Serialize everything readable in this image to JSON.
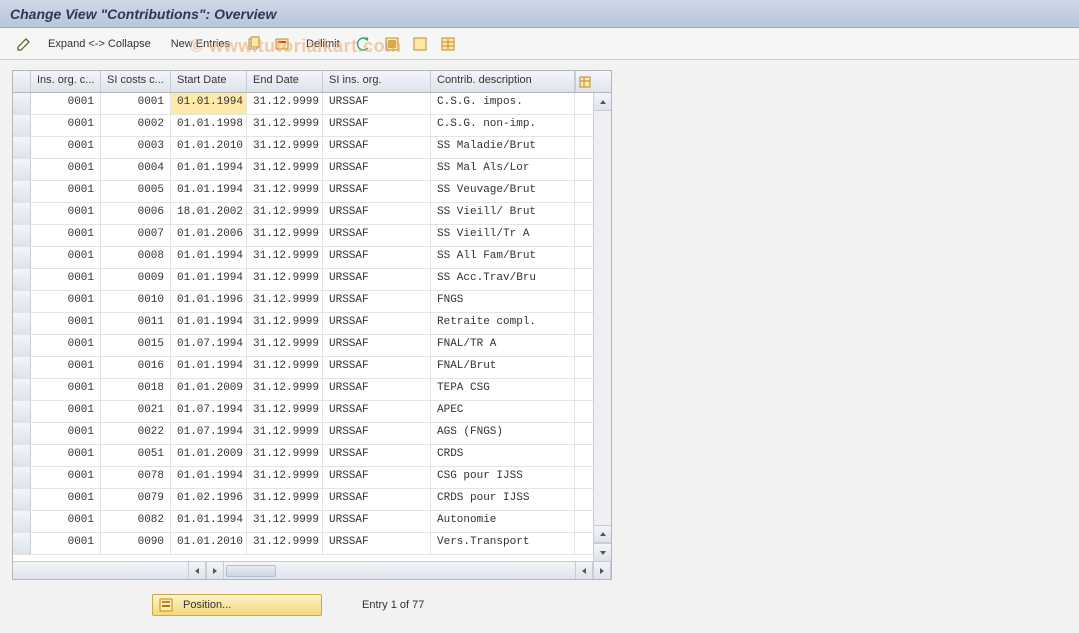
{
  "title": "Change View \"Contributions\": Overview",
  "toolbar": {
    "expand_collapse": "Expand <-> Collapse",
    "new_entries": "New Entries",
    "delimit": "Delimit"
  },
  "columns": {
    "mark": "",
    "ins_org": "Ins. org. c...",
    "si_costs": "SI costs c...",
    "start": "Start Date",
    "end": "End Date",
    "si_ins_org": "SI ins. org.",
    "contrib": "Contrib. description"
  },
  "rows": [
    {
      "org": "0001",
      "cost": "0001",
      "start": "01.01.1994",
      "end": "31.12.9999",
      "si": "URSSAF",
      "desc": "C.S.G. impos."
    },
    {
      "org": "0001",
      "cost": "0002",
      "start": "01.01.1998",
      "end": "31.12.9999",
      "si": "URSSAF",
      "desc": "C.S.G. non-imp."
    },
    {
      "org": "0001",
      "cost": "0003",
      "start": "01.01.2010",
      "end": "31.12.9999",
      "si": "URSSAF",
      "desc": "SS Maladie/Brut"
    },
    {
      "org": "0001",
      "cost": "0004",
      "start": "01.01.1994",
      "end": "31.12.9999",
      "si": "URSSAF",
      "desc": "SS Mal Als/Lor"
    },
    {
      "org": "0001",
      "cost": "0005",
      "start": "01.01.1994",
      "end": "31.12.9999",
      "si": "URSSAF",
      "desc": "SS Veuvage/Brut"
    },
    {
      "org": "0001",
      "cost": "0006",
      "start": "18.01.2002",
      "end": "31.12.9999",
      "si": "URSSAF",
      "desc": "SS Vieill/ Brut"
    },
    {
      "org": "0001",
      "cost": "0007",
      "start": "01.01.2006",
      "end": "31.12.9999",
      "si": "URSSAF",
      "desc": "SS Vieill/Tr A"
    },
    {
      "org": "0001",
      "cost": "0008",
      "start": "01.01.1994",
      "end": "31.12.9999",
      "si": "URSSAF",
      "desc": "SS All Fam/Brut"
    },
    {
      "org": "0001",
      "cost": "0009",
      "start": "01.01.1994",
      "end": "31.12.9999",
      "si": "URSSAF",
      "desc": "SS Acc.Trav/Bru"
    },
    {
      "org": "0001",
      "cost": "0010",
      "start": "01.01.1996",
      "end": "31.12.9999",
      "si": "URSSAF",
      "desc": "FNGS"
    },
    {
      "org": "0001",
      "cost": "0011",
      "start": "01.01.1994",
      "end": "31.12.9999",
      "si": "URSSAF",
      "desc": "Retraite compl."
    },
    {
      "org": "0001",
      "cost": "0015",
      "start": "01.07.1994",
      "end": "31.12.9999",
      "si": "URSSAF",
      "desc": "FNAL/TR A"
    },
    {
      "org": "0001",
      "cost": "0016",
      "start": "01.01.1994",
      "end": "31.12.9999",
      "si": "URSSAF",
      "desc": "FNAL/Brut"
    },
    {
      "org": "0001",
      "cost": "0018",
      "start": "01.01.2009",
      "end": "31.12.9999",
      "si": "URSSAF",
      "desc": "TEPA CSG"
    },
    {
      "org": "0001",
      "cost": "0021",
      "start": "01.07.1994",
      "end": "31.12.9999",
      "si": "URSSAF",
      "desc": "APEC"
    },
    {
      "org": "0001",
      "cost": "0022",
      "start": "01.07.1994",
      "end": "31.12.9999",
      "si": "URSSAF",
      "desc": "AGS (FNGS)"
    },
    {
      "org": "0001",
      "cost": "0051",
      "start": "01.01.2009",
      "end": "31.12.9999",
      "si": "URSSAF",
      "desc": "CRDS"
    },
    {
      "org": "0001",
      "cost": "0078",
      "start": "01.01.1994",
      "end": "31.12.9999",
      "si": "URSSAF",
      "desc": "CSG pour IJSS"
    },
    {
      "org": "0001",
      "cost": "0079",
      "start": "01.02.1996",
      "end": "31.12.9999",
      "si": "URSSAF",
      "desc": "CRDS pour IJSS"
    },
    {
      "org": "0001",
      "cost": "0082",
      "start": "01.01.1994",
      "end": "31.12.9999",
      "si": "URSSAF",
      "desc": "Autonomie"
    },
    {
      "org": "0001",
      "cost": "0090",
      "start": "01.01.2010",
      "end": "31.12.9999",
      "si": "URSSAF",
      "desc": "Vers.Transport"
    }
  ],
  "selected_cell": {
    "row": 0,
    "col": "start"
  },
  "footer": {
    "position_label": "Position...",
    "entry_text": "Entry 1 of 77"
  },
  "watermark": "© www.tutorialkart.com"
}
